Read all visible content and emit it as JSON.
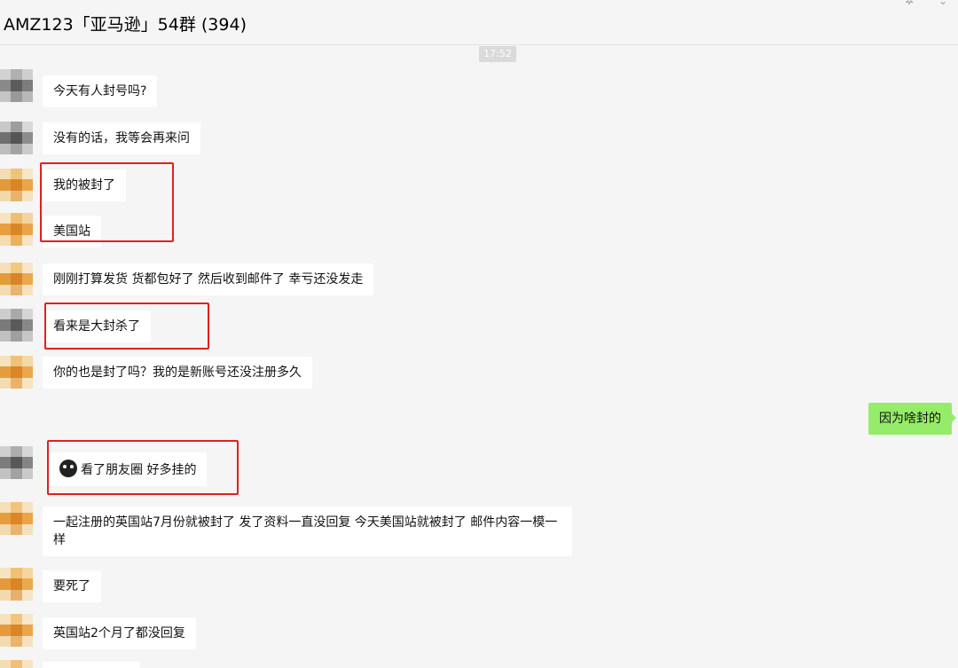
{
  "chat": {
    "title": "AMZ123「亚马逊」54群 (394)",
    "timestamp": "17:52"
  },
  "icons": {
    "pin": "pin-icon",
    "more": "more-icon",
    "emoji": "owl-emoji-icon"
  },
  "colors": {
    "self_bubble": "#95ec69",
    "highlight_box": "#e0201f",
    "background": "#f5f5f5"
  },
  "messages": [
    {
      "text": "今天有人封号吗?"
    },
    {
      "text": "没有的话，我等会再来问"
    },
    {
      "text": "我的被封了"
    },
    {
      "text": "美国站"
    },
    {
      "text": "刚刚打算发货 货都包好了 然后收到邮件了 幸亏还没发走"
    },
    {
      "text": "看来是大封杀了"
    },
    {
      "text": "你的也是封了吗？我的是新账号还没注册多久"
    },
    {
      "text": "因为啥封的"
    },
    {
      "text": "看了朋友圈 好多挂的"
    },
    {
      "text": "一起注册的英国站7月份就被封了 发了资料一直没回复 今天美国站就被封了 邮件内容一模一样"
    },
    {
      "text": "要死了"
    },
    {
      "text": "英国站2个月了都没回复"
    }
  ]
}
